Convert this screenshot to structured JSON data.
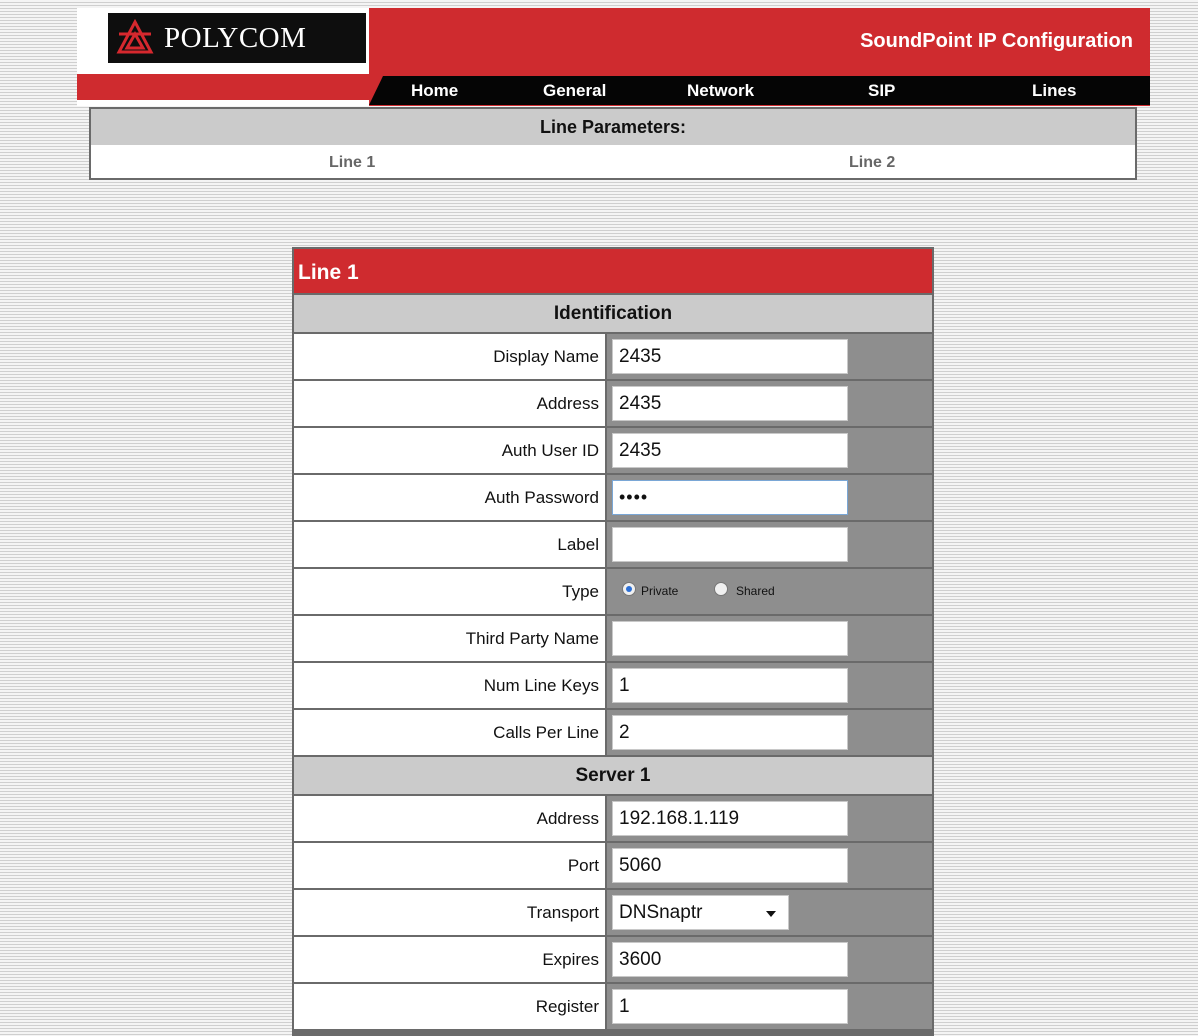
{
  "header": {
    "logo_text": "POLYCOM",
    "title": "SoundPoint IP Configuration",
    "nav": [
      "Home",
      "General",
      "Network",
      "SIP",
      "Lines"
    ]
  },
  "line_params": {
    "title": "Line Parameters:",
    "lines": [
      "Line 1",
      "Line 2"
    ]
  },
  "card": {
    "title": "Line 1",
    "identification": {
      "title": "Identification",
      "display_name_label": "Display Name",
      "display_name": "2435",
      "address_label": "Address",
      "address": "2435",
      "auth_user_id_label": "Auth User ID",
      "auth_user_id": "2435",
      "auth_password_label": "Auth Password",
      "auth_password": "••••",
      "label_label": "Label",
      "label": "",
      "type_label": "Type",
      "type_options": [
        "Private",
        "Shared"
      ],
      "type_selected": "Private",
      "third_party_name_label": "Third Party Name",
      "third_party_name": "",
      "num_line_keys_label": "Num Line Keys",
      "num_line_keys": "1",
      "calls_per_line_label": "Calls Per Line",
      "calls_per_line": "2"
    },
    "server1": {
      "title": "Server 1",
      "address_label": "Address",
      "address": "192.168.1.119",
      "port_label": "Port",
      "port": "5060",
      "transport_label": "Transport",
      "transport": "DNSnaptr",
      "expires_label": "Expires",
      "expires": "3600",
      "register_label": "Register",
      "register": "1"
    }
  },
  "colors": {
    "brand_red": "#cf2b2f",
    "nav_black": "#050505",
    "section_gray": "#cbcbcb"
  }
}
